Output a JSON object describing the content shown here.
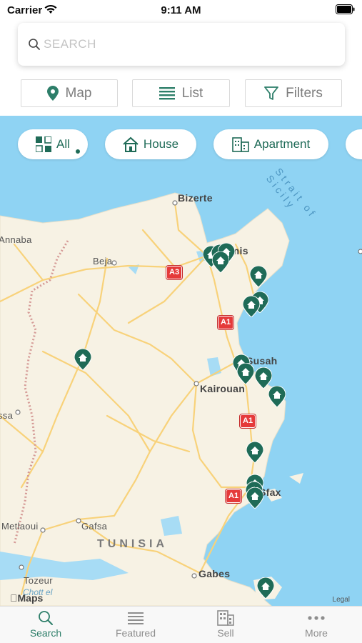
{
  "status_bar": {
    "carrier": "Carrier",
    "time": "9:11 AM"
  },
  "search": {
    "placeholder": "SEARCH"
  },
  "toolbar": {
    "map_label": "Map",
    "list_label": "List",
    "filters_label": "Filters"
  },
  "categories": [
    {
      "label": "All",
      "icon": "grid-icon",
      "selected": true
    },
    {
      "label": "House",
      "icon": "house-icon"
    },
    {
      "label": "Apartment",
      "icon": "building-icon"
    }
  ],
  "map": {
    "cities": {
      "bizerte": "Bizerte",
      "tunis": "Tunis",
      "beja": "Beja",
      "annaba": "Annaba",
      "susah": "Susah",
      "kairouan": "Kairouan",
      "sfax": "Sfax",
      "tebessa": "ssa",
      "metlaoui": "Metlaoui",
      "gafsa": "Gafsa",
      "tozeur": "Tozeur",
      "gabes": "Gabes"
    },
    "country": "TUNISIA",
    "strait": "Strait of Sicily",
    "water": "Chott el",
    "roads": {
      "a3": "A3",
      "a1_north": "A1",
      "a1_mid": "A1",
      "a1_south": "A1"
    },
    "attribution": "Maps",
    "legal": "Legal",
    "colors": {
      "land": "#f7f2e4",
      "water": "#8fd3f3",
      "pin": "#1f6b57",
      "road": "#f8d27a",
      "border": "#d59a96"
    }
  },
  "tabs": [
    {
      "label": "Search",
      "icon": "search-icon",
      "active": true
    },
    {
      "label": "Featured",
      "icon": "list-icon"
    },
    {
      "label": "Sell",
      "icon": "building-icon"
    },
    {
      "label": "More",
      "icon": "more-icon"
    }
  ]
}
